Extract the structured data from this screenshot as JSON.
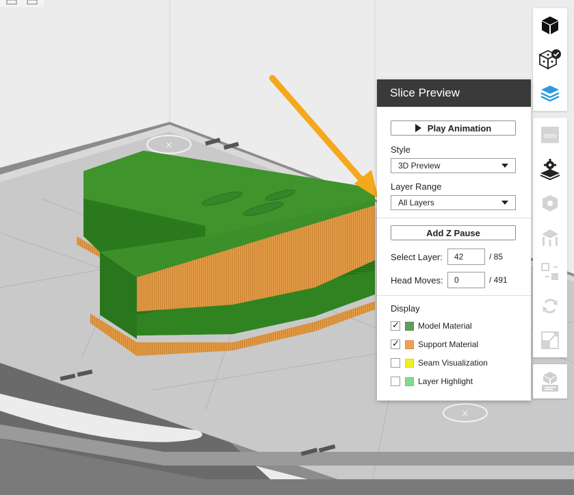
{
  "colors": {
    "model_material": "#5e9e5e",
    "support_material": "#f0a150",
    "seam_visualization": "#f0f020",
    "layer_highlight": "#7fdc8a",
    "active_tool": "#2d9bd7",
    "arrow": "#f5a81c"
  },
  "panel": {
    "title": "Slice Preview",
    "play_label": "Play Animation",
    "style_label": "Style",
    "style_value": "3D Preview",
    "layer_range_label": "Layer Range",
    "layer_range_value": "All Layers",
    "z_pause_label": "Add Z Pause",
    "select_layer_label": "Select Layer:",
    "select_layer_value": "42",
    "select_layer_total": "/ 85",
    "head_moves_label": "Head Moves:",
    "head_moves_value": "0",
    "head_moves_total": "/ 491",
    "display_label": "Display",
    "display_items": [
      {
        "label": "Model Material",
        "checked": true
      },
      {
        "label": "Support Material",
        "checked": true
      },
      {
        "label": "Seam Visualization",
        "checked": false
      },
      {
        "label": "Layer Highlight",
        "checked": false
      }
    ]
  },
  "toolbar": {
    "units_label": "mm",
    "icons": [
      "cube-icon",
      "dice-check-icon",
      "layers-icon",
      "mm-units-icon",
      "slice-settings-icon",
      "gear-cube-icon",
      "support-icon",
      "move-icon",
      "rotate-icon",
      "scale-icon",
      "export-icon"
    ]
  }
}
